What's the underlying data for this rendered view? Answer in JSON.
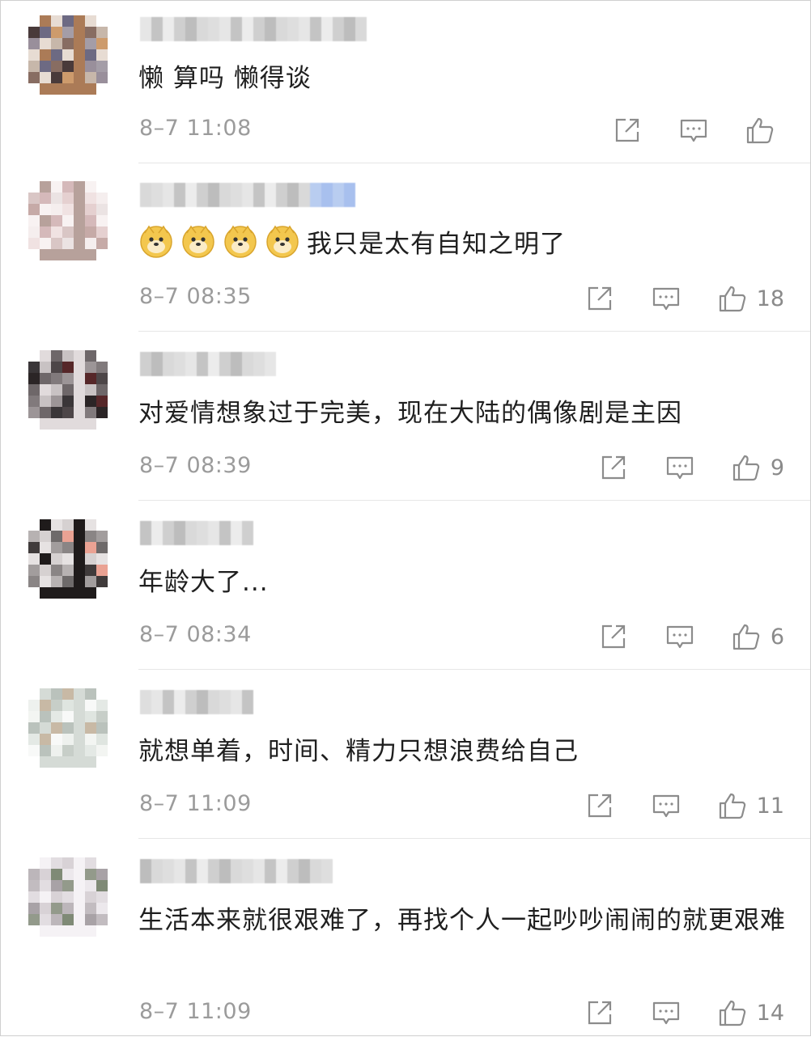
{
  "comments": [
    {
      "text": "懒 算吗 懒得谈",
      "time": "8–7 11:08",
      "likes": ""
    },
    {
      "text": "我只是太有自知之明了",
      "time": "8–7 08:35",
      "likes": "18",
      "emoji_prefix": [
        "doge-emoji",
        "doge-emoji",
        "doge-emoji",
        "doge-emoji"
      ]
    },
    {
      "text": "对爱情想象过于完美，现在大陆的偶像剧是主因",
      "time": "8–7 08:39",
      "likes": "9"
    },
    {
      "text": "年龄大了...",
      "time": "8–7 08:34",
      "likes": "6"
    },
    {
      "text": "就想单着，时间、精力只想浪费给自己",
      "time": "8–7 11:09",
      "likes": "11"
    },
    {
      "text": "生活本来就很艰难了，再找个人一起吵吵闹闹的就更艰难",
      "time": "8–7 11:09",
      "likes": "14"
    }
  ],
  "icons": {
    "share": "share-icon",
    "reply": "comment-icon",
    "like": "thumbs-up-icon",
    "emoji": "doge-emoji"
  },
  "colors": {
    "text": "#1f1f1f",
    "meta": "#9b9b9b",
    "icon": "#8c8c8c",
    "divider": "#e6e6e6"
  }
}
